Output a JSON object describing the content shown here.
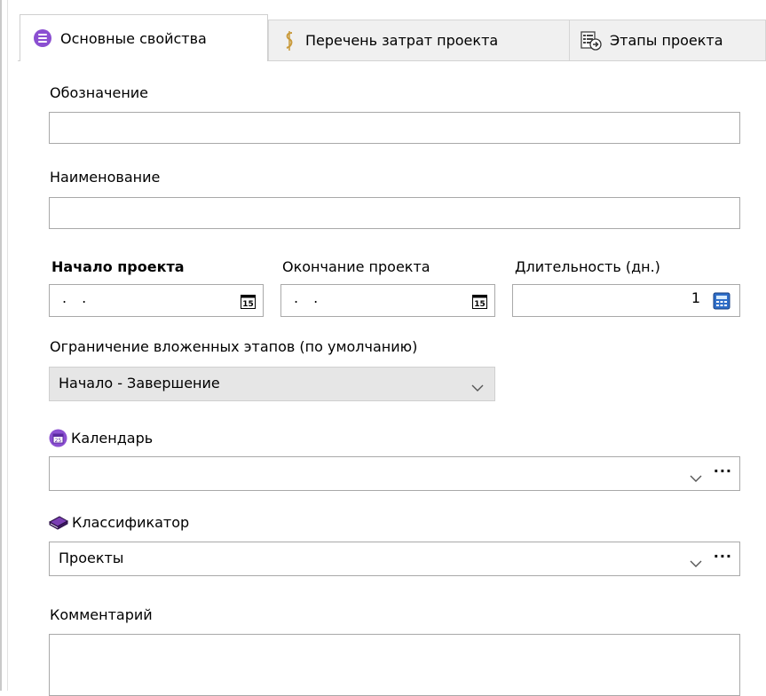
{
  "tabs": [
    {
      "label": "Основные свойства",
      "icon": "list-circle-icon",
      "active": true
    },
    {
      "label": "Перечень затрат проекта",
      "icon": "dollar-scroll-icon",
      "active": false
    },
    {
      "label": "Этапы проекта",
      "icon": "stages-list-icon",
      "active": false
    }
  ],
  "form": {
    "designation": {
      "label": "Обозначение",
      "value": ""
    },
    "name": {
      "label": "Наименование",
      "value": ""
    },
    "start": {
      "label": "Начало проекта",
      "value": ". ."
    },
    "end": {
      "label": "Окончание проекта",
      "value": ". ."
    },
    "duration": {
      "label": "Длительность (дн.)",
      "value": "1"
    },
    "constraint": {
      "label": "Ограничение вложенных этапов (по умолчанию)",
      "value": "Начало - Завершение"
    },
    "calendar": {
      "label": "Календарь",
      "value": "",
      "icon": "calendar-icon"
    },
    "classifier": {
      "label": "Классификатор",
      "value": "Проекты",
      "icon": "book-icon"
    },
    "comment": {
      "label": "Комментарий",
      "value": ""
    }
  },
  "colors": {
    "accent_purple": "#8b4fd1",
    "book": "#5b2a8c",
    "calc_blue": "#2f6ec8"
  }
}
